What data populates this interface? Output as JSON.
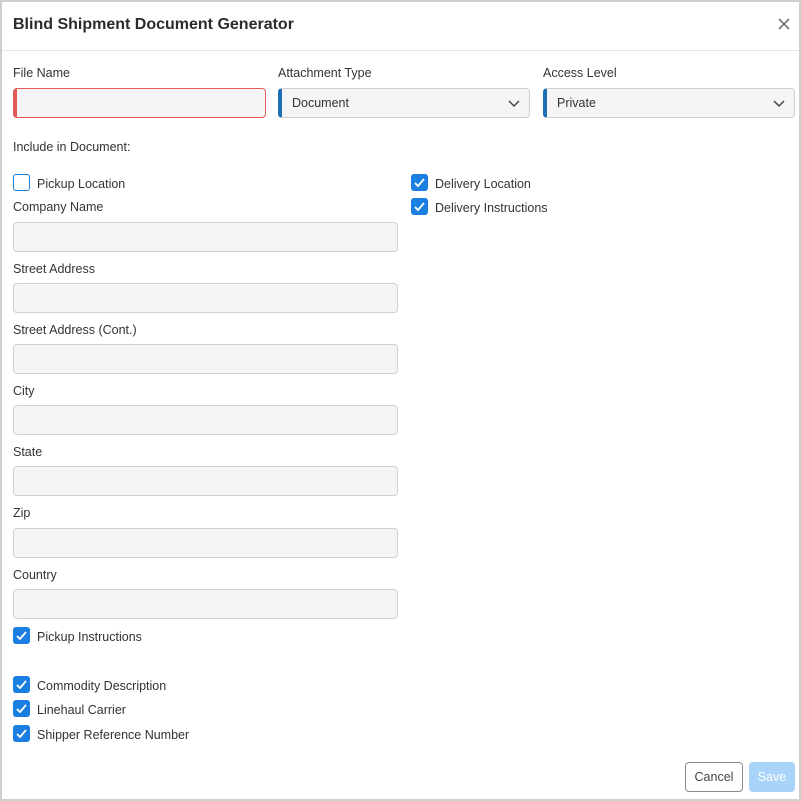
{
  "dialog": {
    "title": "Blind Shipment Document Generator",
    "close_icon": "close-icon"
  },
  "top_fields": {
    "file_name": {
      "label": "File Name",
      "value": ""
    },
    "attachment_type": {
      "label": "Attachment Type",
      "value": "Document"
    },
    "access_level": {
      "label": "Access Level",
      "value": "Private"
    }
  },
  "include_label": "Include in Document:",
  "checkboxes": {
    "pickup_location": {
      "label": "Pickup Location",
      "checked": false
    },
    "delivery_location": {
      "label": "Delivery Location",
      "checked": true
    },
    "delivery_instructions": {
      "label": "Delivery Instructions",
      "checked": true
    },
    "pickup_instructions": {
      "label": "Pickup Instructions",
      "checked": true
    },
    "commodity_description": {
      "label": "Commodity Description",
      "checked": true
    },
    "linehaul_carrier": {
      "label": "Linehaul Carrier",
      "checked": true
    },
    "shipper_reference_number": {
      "label": "Shipper Reference Number",
      "checked": true
    }
  },
  "pickup_fields": {
    "company_name": {
      "label": "Company Name",
      "value": ""
    },
    "street_address": {
      "label": "Street Address",
      "value": ""
    },
    "street_address_cont": {
      "label": "Street Address (Cont.)",
      "value": ""
    },
    "city": {
      "label": "City",
      "value": ""
    },
    "state": {
      "label": "State",
      "value": ""
    },
    "zip": {
      "label": "Zip",
      "value": ""
    },
    "country": {
      "label": "Country",
      "value": ""
    }
  },
  "footer": {
    "cancel_label": "Cancel",
    "save_label": "Save"
  },
  "colors": {
    "accent": "#1f6fb5",
    "checkbox": "#1a7fe0",
    "error": "#e25a56",
    "save_disabled": "#a9d3f8"
  }
}
